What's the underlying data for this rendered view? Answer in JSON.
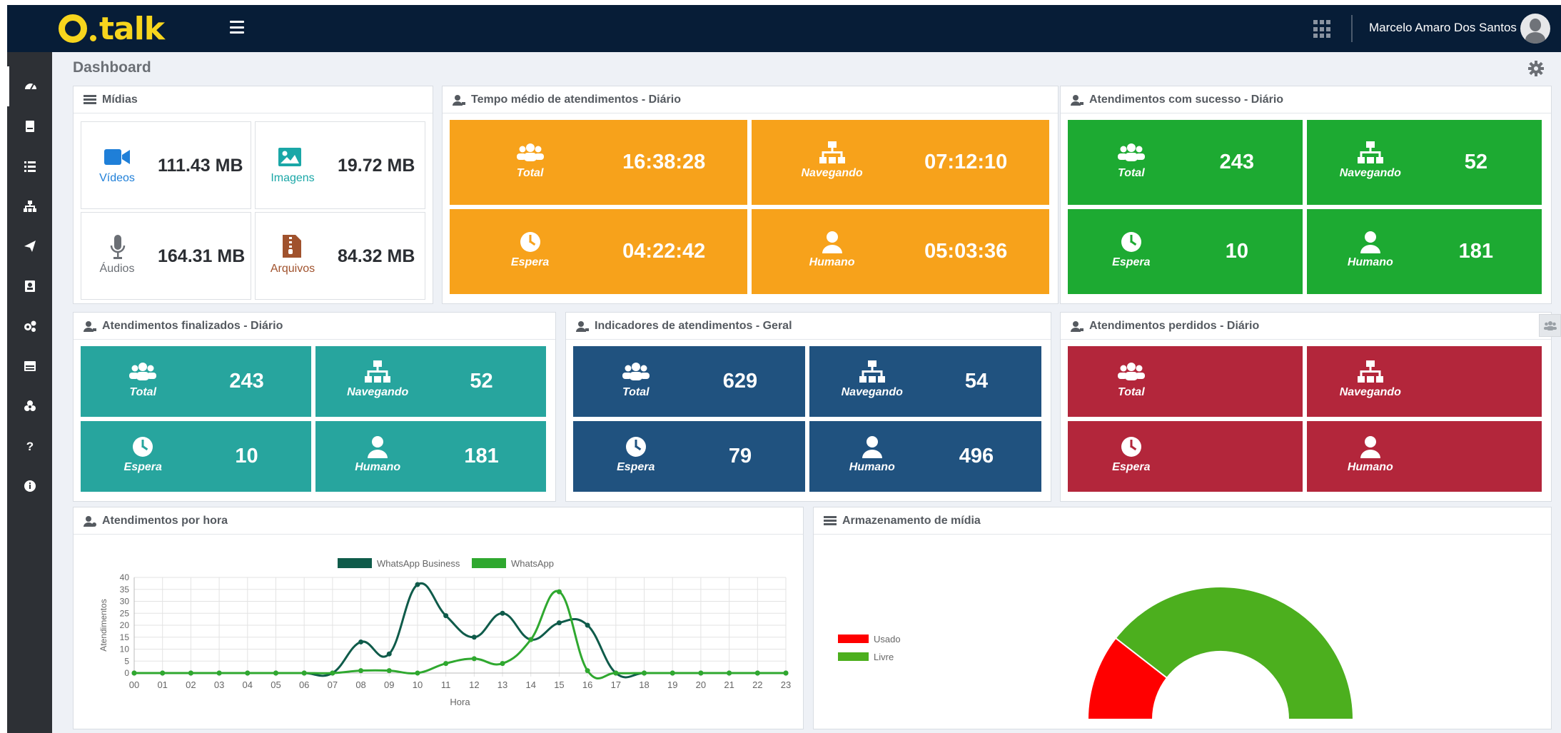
{
  "header": {
    "brand": "talk",
    "user_name": "Marcelo Amaro Dos Santos"
  },
  "sidebar": {
    "items": [
      "dashboard-icon",
      "book-icon",
      "list-icon",
      "sitemap-icon",
      "send-icon",
      "contact-card-icon",
      "cogs-icon",
      "store-icon",
      "biohazard-icon",
      "help-icon",
      "info-icon"
    ]
  },
  "page": {
    "title": "Dashboard"
  },
  "midias": {
    "title": "Mídias",
    "items": [
      {
        "label": "Vídeos",
        "value": "111.43 MB",
        "color": "#1f7fd8"
      },
      {
        "label": "Imagens",
        "value": "19.72 MB",
        "color": "#1aa7a7"
      },
      {
        "label": "Áudios",
        "value": "164.31 MB",
        "color": "#6b6f75"
      },
      {
        "label": "Arquivos",
        "value": "84.32 MB",
        "color": "#a0522d"
      }
    ]
  },
  "tempo": {
    "title": "Tempo médio de atendimentos - Diário",
    "color": "#f7a21b",
    "tiles": [
      {
        "label": "Total",
        "value": "16:38:28",
        "icon": "users-icon"
      },
      {
        "label": "Navegando",
        "value": "07:12:10",
        "icon": "sitemap-icon"
      },
      {
        "label": "Espera",
        "value": "04:22:42",
        "icon": "clock-icon"
      },
      {
        "label": "Humano",
        "value": "05:03:36",
        "icon": "user-icon"
      }
    ]
  },
  "sucesso": {
    "title": "Atendimentos com sucesso - Diário",
    "color": "#1daa32",
    "tiles": [
      {
        "label": "Total",
        "value": "243",
        "icon": "users-icon"
      },
      {
        "label": "Navegando",
        "value": "52",
        "icon": "sitemap-icon"
      },
      {
        "label": "Espera",
        "value": "10",
        "icon": "clock-icon"
      },
      {
        "label": "Humano",
        "value": "181",
        "icon": "user-icon"
      }
    ]
  },
  "finalizados": {
    "title": "Atendimentos finalizados - Diário",
    "color": "#27a59e",
    "tiles": [
      {
        "label": "Total",
        "value": "243",
        "icon": "users-icon"
      },
      {
        "label": "Navegando",
        "value": "52",
        "icon": "sitemap-icon"
      },
      {
        "label": "Espera",
        "value": "10",
        "icon": "clock-icon"
      },
      {
        "label": "Humano",
        "value": "181",
        "icon": "user-icon"
      }
    ]
  },
  "indicadores": {
    "title": "Indicadores de atendimentos - Geral",
    "color": "#20527f",
    "tiles": [
      {
        "label": "Total",
        "value": "629",
        "icon": "users-icon"
      },
      {
        "label": "Navegando",
        "value": "54",
        "icon": "sitemap-icon"
      },
      {
        "label": "Espera",
        "value": "79",
        "icon": "clock-icon"
      },
      {
        "label": "Humano",
        "value": "496",
        "icon": "user-icon"
      }
    ]
  },
  "perdidos": {
    "title": "Atendimentos perdidos - Diário",
    "color": "#b3263b",
    "tiles": [
      {
        "label": "Total",
        "value": "",
        "icon": "users-icon"
      },
      {
        "label": "Navegando",
        "value": "",
        "icon": "sitemap-icon"
      },
      {
        "label": "Espera",
        "value": "",
        "icon": "clock-icon"
      },
      {
        "label": "Humano",
        "value": "",
        "icon": "user-icon"
      }
    ]
  },
  "por_hora": {
    "title": "Atendimentos por hora"
  },
  "armazenamento": {
    "title": "Armazenamento de mídia"
  },
  "chart_data": [
    {
      "type": "line",
      "x": [
        "00",
        "01",
        "02",
        "03",
        "04",
        "05",
        "06",
        "07",
        "08",
        "09",
        "10",
        "11",
        "12",
        "13",
        "14",
        "15",
        "16",
        "17",
        "18",
        "19",
        "20",
        "21",
        "22",
        "23"
      ],
      "series": [
        {
          "name": "WhatsApp Business",
          "color": "#0f5b4a",
          "values": [
            0,
            0,
            0,
            0,
            0,
            0,
            0,
            0,
            13,
            8,
            37,
            24,
            15,
            25,
            14,
            21,
            20,
            0,
            0,
            0,
            0,
            0,
            0,
            0
          ]
        },
        {
          "name": "WhatsApp",
          "color": "#2fa82f",
          "values": [
            0,
            0,
            0,
            0,
            0,
            0,
            0,
            0,
            1,
            1,
            0,
            4,
            6,
            4,
            14,
            34,
            1,
            0,
            0,
            0,
            0,
            0,
            0,
            0
          ]
        }
      ],
      "xlabel": "Hora",
      "ylabel": "Atendimentos",
      "ylim": [
        0,
        40
      ],
      "yticks": [
        0,
        5,
        10,
        15,
        20,
        25,
        30,
        35,
        40
      ],
      "legend": "top",
      "grid": true
    },
    {
      "type": "pie",
      "labels": [
        "Usado",
        "Livre"
      ],
      "values": [
        21,
        79
      ],
      "colors": [
        "#ff0000",
        "#4caf1e"
      ],
      "legend": "left"
    }
  ]
}
